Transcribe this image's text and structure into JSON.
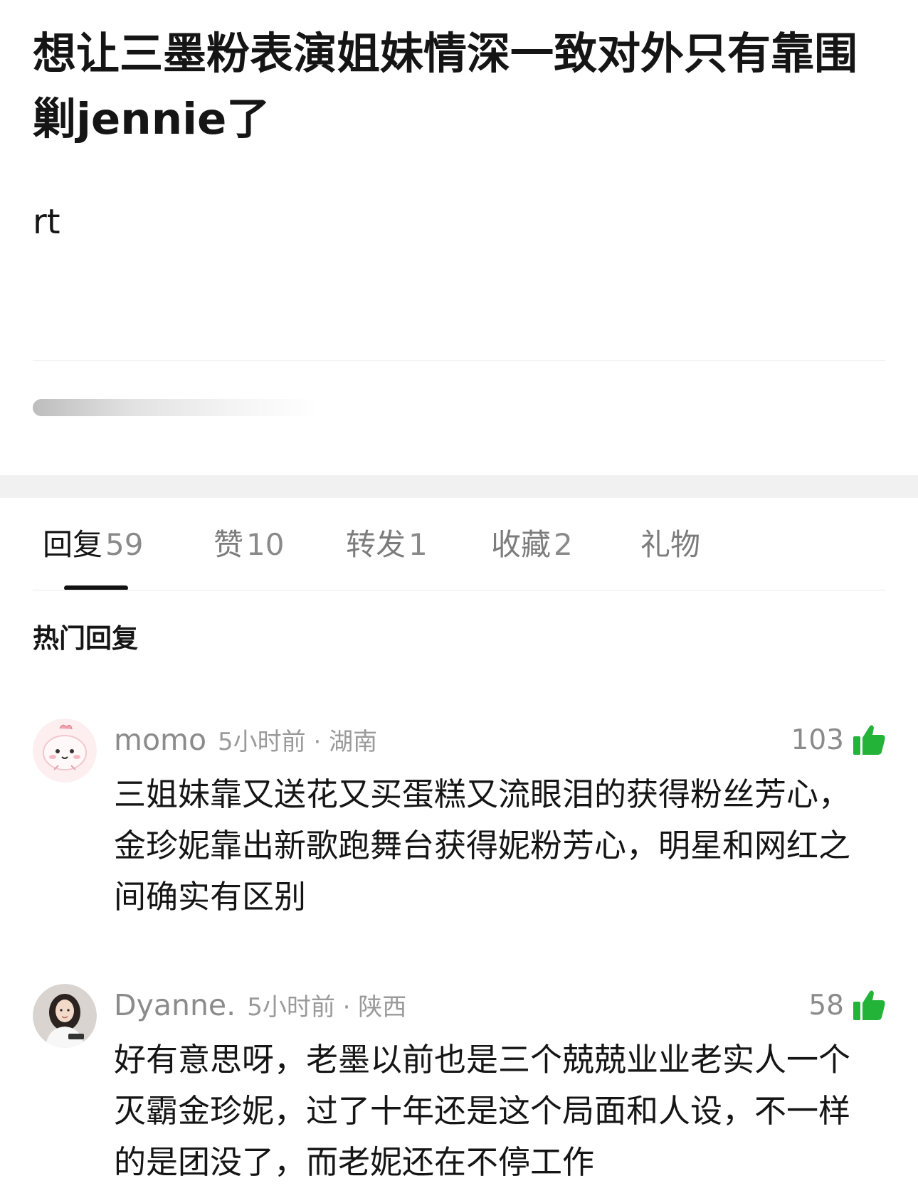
{
  "post": {
    "title": "想让三墨粉表演姐妹情深一致对外只有靠围剿jennie了",
    "body": "rt"
  },
  "tabs": [
    {
      "label": "回复",
      "count": "59"
    },
    {
      "label": "赞",
      "count": "10"
    },
    {
      "label": "转发",
      "count": "1"
    },
    {
      "label": "收藏",
      "count": "2"
    },
    {
      "label": "礼物",
      "count": ""
    }
  ],
  "hot_label": "热门回复",
  "comments": [
    {
      "user": "momo",
      "time": "5小时前 · 湖南",
      "likes": "103",
      "text": "三姐妹靠又送花又买蛋糕又流眼泪的获得粉丝芳心，金珍妮靠出新歌跑舞台获得妮粉芳心，明星和网红之间确实有区别",
      "avatar_icon": "cartoon-avatar-icon"
    },
    {
      "user": "Dyanne.",
      "time": "5小时前 · 陕西",
      "likes": "58",
      "text": "好有意思呀，老墨以前也是三个兢兢业业老实人一个灭霸金珍妮，过了十年还是这个局面和人设，不一样的是团没了，而老妮还在不停工作",
      "avatar_icon": "photo-avatar-icon"
    }
  ],
  "colors": {
    "like_green": "#23b339",
    "text_dark": "#151515",
    "text_gray": "#8b8b8b",
    "section_gray": "#f1f1f1"
  }
}
